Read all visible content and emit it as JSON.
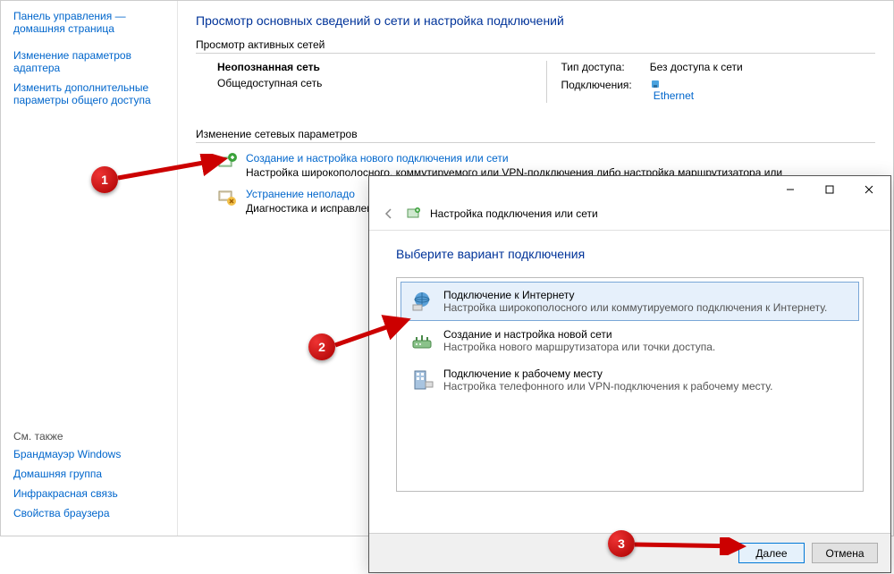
{
  "sidebar": {
    "home": "Панель управления — домашняя страница",
    "links": [
      "Изменение параметров адаптера",
      "Изменить дополнительные параметры общего доступа"
    ],
    "see_also_title": "См. также",
    "see_also": [
      "Брандмауэр Windows",
      "Домашняя группа",
      "Инфракрасная связь",
      "Свойства браузера"
    ]
  },
  "content": {
    "title": "Просмотр основных сведений о сети и настройка подключений",
    "active_networks_label": "Просмотр активных сетей",
    "network": {
      "name": "Неопознанная сеть",
      "type": "Общедоступная сеть",
      "access_label": "Тип доступа:",
      "access_value": "Без доступа к сети",
      "connections_label": "Подключения:",
      "connections_value": "Ethernet"
    },
    "change_settings_label": "Изменение сетевых параметров",
    "tasks": [
      {
        "title": "Создание и настройка нового подключения или сети",
        "desc": "Настройка широкополосного, коммутируемого или VPN-подключения либо настройка маршрутизатора или"
      },
      {
        "title": "Устранение неполадо",
        "desc": "Диагностика и исправление неполадок."
      }
    ]
  },
  "dialog": {
    "header": "Настройка подключения или сети",
    "heading": "Выберите вариант подключения",
    "options": [
      {
        "title": "Подключение к Интернету",
        "desc": "Настройка широкополосного или коммутируемого подключения к Интернету."
      },
      {
        "title": "Создание и настройка новой сети",
        "desc": "Настройка нового маршрутизатора или точки доступа."
      },
      {
        "title": "Подключение к рабочему месту",
        "desc": "Настройка телефонного или VPN-подключения к рабочему месту."
      }
    ],
    "next": "Далее",
    "cancel": "Отмена"
  },
  "markers": [
    "1",
    "2",
    "3"
  ]
}
